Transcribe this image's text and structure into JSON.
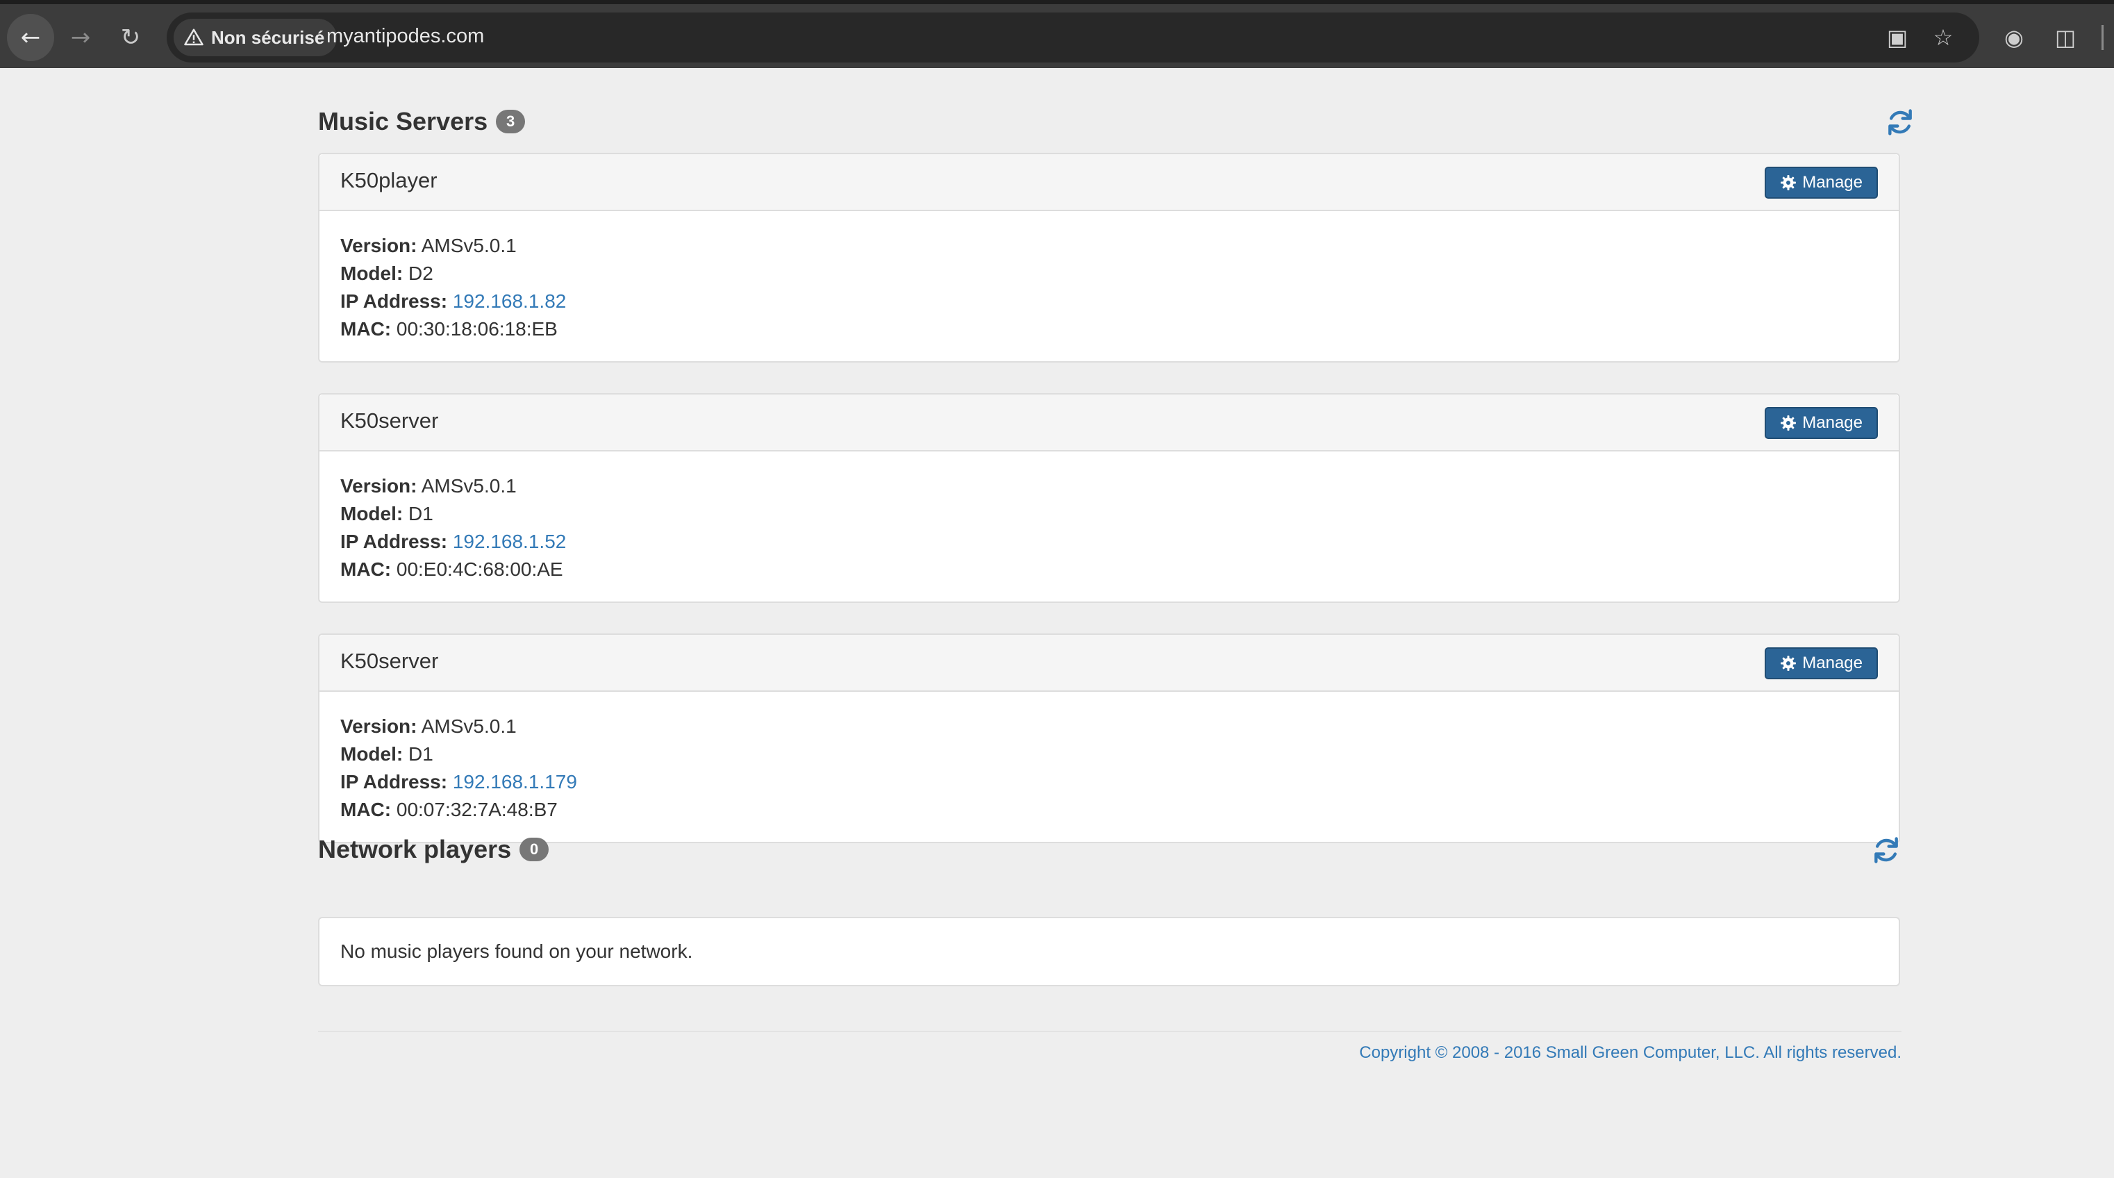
{
  "browser": {
    "security_label": "Non sécurisé",
    "url": "myantipodes.com"
  },
  "music_servers": {
    "title": "Music Servers",
    "count": "3",
    "servers": [
      {
        "name": "K50player",
        "manage_label": "Manage",
        "version_label": "Version:",
        "version": "AMSv5.0.1",
        "model_label": "Model:",
        "model": "D2",
        "ip_label": "IP Address:",
        "ip": "192.168.1.82",
        "mac_label": "MAC:",
        "mac": "00:30:18:06:18:EB"
      },
      {
        "name": "K50server",
        "manage_label": "Manage",
        "version_label": "Version:",
        "version": "AMSv5.0.1",
        "model_label": "Model:",
        "model": "D1",
        "ip_label": "IP Address:",
        "ip": "192.168.1.52",
        "mac_label": "MAC:",
        "mac": "00:E0:4C:68:00:AE"
      },
      {
        "name": "K50server",
        "manage_label": "Manage",
        "version_label": "Version:",
        "version": "AMSv5.0.1",
        "model_label": "Model:",
        "model": "D1",
        "ip_label": "IP Address:",
        "ip": "192.168.1.179",
        "mac_label": "MAC:",
        "mac": "00:07:32:7A:48:B7"
      }
    ]
  },
  "network_players": {
    "title": "Network players",
    "count": "0",
    "empty_message": "No music players found on your network."
  },
  "footer": {
    "copyright": "Copyright © 2008 - 2016 Small Green Computer, LLC. All rights reserved."
  },
  "colors": {
    "accent": "#337ab7",
    "button": "#2b6496",
    "badge": "#777777"
  }
}
